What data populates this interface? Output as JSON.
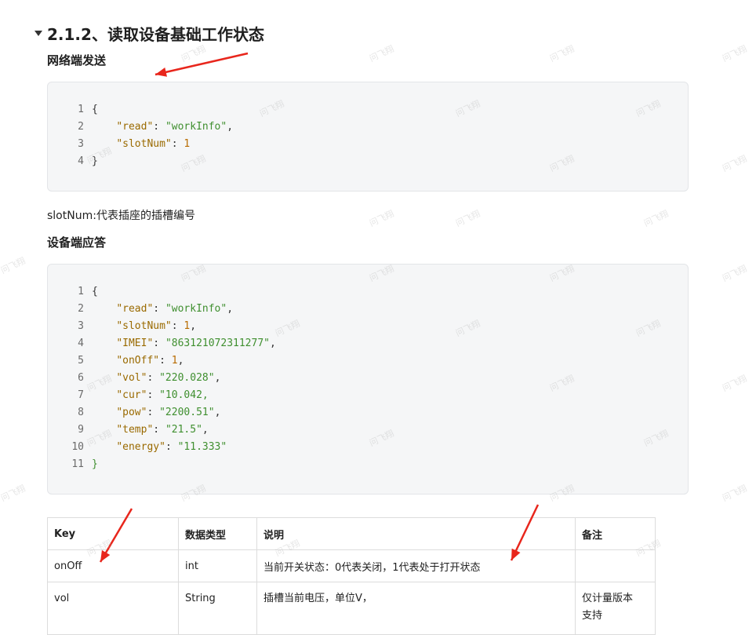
{
  "heading": {
    "title": "2.1.2、读取设备基础工作状态"
  },
  "section_send": {
    "title": "网络端发送"
  },
  "send_code": [
    {
      "n": "1",
      "parts": [
        {
          "t": "{",
          "c": "punc"
        }
      ]
    },
    {
      "n": "2",
      "parts": [
        {
          "t": "    ",
          "c": "punc"
        },
        {
          "t": "\"read\"",
          "c": "key"
        },
        {
          "t": ": ",
          "c": "punc"
        },
        {
          "t": "\"workInfo\"",
          "c": "str"
        },
        {
          "t": ",",
          "c": "punc"
        }
      ]
    },
    {
      "n": "3",
      "parts": [
        {
          "t": "    ",
          "c": "punc"
        },
        {
          "t": "\"slotNum\"",
          "c": "key"
        },
        {
          "t": ": ",
          "c": "punc"
        },
        {
          "t": "1",
          "c": "num"
        }
      ]
    },
    {
      "n": "4",
      "parts": [
        {
          "t": "}",
          "c": "punc"
        }
      ]
    }
  ],
  "slot_note": "slotNum:代表插座的插槽编号",
  "section_reply": {
    "title": "设备端应答"
  },
  "reply_code": [
    {
      "n": "1",
      "parts": [
        {
          "t": "{",
          "c": "punc"
        }
      ]
    },
    {
      "n": "2",
      "parts": [
        {
          "t": "    ",
          "c": "punc"
        },
        {
          "t": "\"read\"",
          "c": "key"
        },
        {
          "t": ": ",
          "c": "punc"
        },
        {
          "t": "\"workInfo\"",
          "c": "str"
        },
        {
          "t": ",",
          "c": "punc"
        }
      ]
    },
    {
      "n": "3",
      "parts": [
        {
          "t": "    ",
          "c": "punc"
        },
        {
          "t": "\"slotNum\"",
          "c": "key"
        },
        {
          "t": ": ",
          "c": "punc"
        },
        {
          "t": "1",
          "c": "num"
        },
        {
          "t": ",",
          "c": "punc"
        }
      ]
    },
    {
      "n": "4",
      "parts": [
        {
          "t": "    ",
          "c": "punc"
        },
        {
          "t": "\"IMEI\"",
          "c": "key"
        },
        {
          "t": ": ",
          "c": "punc"
        },
        {
          "t": "\"863121072311277\"",
          "c": "str"
        },
        {
          "t": ",",
          "c": "punc"
        }
      ]
    },
    {
      "n": "5",
      "parts": [
        {
          "t": "    ",
          "c": "punc"
        },
        {
          "t": "\"onOff\"",
          "c": "key"
        },
        {
          "t": ": ",
          "c": "punc"
        },
        {
          "t": "1",
          "c": "num"
        },
        {
          "t": ",",
          "c": "punc"
        }
      ]
    },
    {
      "n": "6",
      "parts": [
        {
          "t": "    ",
          "c": "punc"
        },
        {
          "t": "\"vol\"",
          "c": "key"
        },
        {
          "t": ": ",
          "c": "punc"
        },
        {
          "t": "\"220.028\"",
          "c": "str"
        },
        {
          "t": ",",
          "c": "punc"
        }
      ]
    },
    {
      "n": "7",
      "parts": [
        {
          "t": "    ",
          "c": "punc"
        },
        {
          "t": "\"cur\"",
          "c": "key"
        },
        {
          "t": ": ",
          "c": "punc"
        },
        {
          "t": "\"10.042,",
          "c": "str"
        }
      ]
    },
    {
      "n": "8",
      "parts": [
        {
          "t": "    ",
          "c": "punc"
        },
        {
          "t": "\"pow\"",
          "c": "key"
        },
        {
          "t": ": ",
          "c": "punc"
        },
        {
          "t": "\"2200.51\"",
          "c": "str"
        },
        {
          "t": ",",
          "c": "punc"
        }
      ]
    },
    {
      "n": "9",
      "parts": [
        {
          "t": "    ",
          "c": "punc"
        },
        {
          "t": "\"temp\"",
          "c": "key"
        },
        {
          "t": ": ",
          "c": "punc"
        },
        {
          "t": "\"21.5\"",
          "c": "str"
        },
        {
          "t": ",",
          "c": "punc"
        }
      ]
    },
    {
      "n": "10",
      "parts": [
        {
          "t": "    ",
          "c": "punc"
        },
        {
          "t": "\"energy\"",
          "c": "key"
        },
        {
          "t": ": ",
          "c": "punc"
        },
        {
          "t": "\"11.333\"",
          "c": "str"
        }
      ]
    },
    {
      "n": "11",
      "parts": [
        {
          "t": "}",
          "c": "str"
        }
      ]
    }
  ],
  "table": {
    "headers": [
      "Key",
      "数据类型",
      "说明",
      "备注"
    ],
    "rows": [
      [
        "onOff",
        "int",
        "当前开关状态：0代表关闭，1代表处于打开状态",
        ""
      ],
      [
        "vol",
        "String",
        "插槽当前电压，单位V，",
        "仅计量版本\n支持"
      ]
    ]
  },
  "watermark": "问飞翔",
  "colors": {
    "arrow": "#e8261c",
    "code_bg": "#f5f6f7",
    "key": "#9a6a00",
    "string": "#3f8f2f",
    "number": "#b86b00"
  }
}
